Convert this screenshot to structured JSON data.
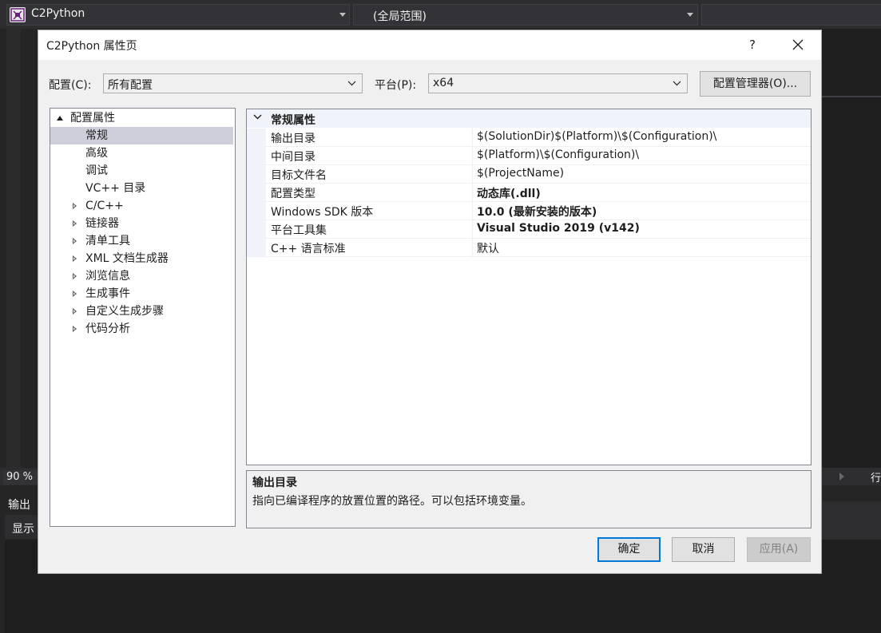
{
  "ide": {
    "project_combo": "C2Python",
    "scope_combo": "(全局范围)",
    "zoom": "90 %",
    "status_right": "行",
    "output_title": "输出",
    "output_show": "显示"
  },
  "dialog": {
    "title": "C2Python 属性页",
    "help": "?",
    "config_label": "配置(C):",
    "config_value": "所有配置",
    "platform_label": "平台(P):",
    "platform_value": "x64",
    "config_manager": "配置管理器(O)...",
    "tree": [
      {
        "label": "配置属性",
        "expander": "expanded",
        "level": 0
      },
      {
        "label": "常规",
        "expander": "none",
        "level": 1,
        "selected": true
      },
      {
        "label": "高级",
        "expander": "none",
        "level": 1
      },
      {
        "label": "调试",
        "expander": "none",
        "level": 1
      },
      {
        "label": "VC++ 目录",
        "expander": "none",
        "level": 1
      },
      {
        "label": "C/C++",
        "expander": "collapsed",
        "level": 1
      },
      {
        "label": "链接器",
        "expander": "collapsed",
        "level": 1
      },
      {
        "label": "清单工具",
        "expander": "collapsed",
        "level": 1
      },
      {
        "label": "XML 文档生成器",
        "expander": "collapsed",
        "level": 1
      },
      {
        "label": "浏览信息",
        "expander": "collapsed",
        "level": 1
      },
      {
        "label": "生成事件",
        "expander": "collapsed",
        "level": 1
      },
      {
        "label": "自定义生成步骤",
        "expander": "collapsed",
        "level": 1
      },
      {
        "label": "代码分析",
        "expander": "collapsed",
        "level": 1
      }
    ],
    "grid": {
      "category": "常规属性",
      "rows": [
        {
          "name": "输出目录",
          "value": "$(SolutionDir)$(Platform)\\$(Configuration)\\",
          "bold": false
        },
        {
          "name": "中间目录",
          "value": "$(Platform)\\$(Configuration)\\",
          "bold": false
        },
        {
          "name": "目标文件名",
          "value": "$(ProjectName)",
          "bold": false
        },
        {
          "name": "配置类型",
          "value": "动态库(.dll)",
          "bold": true
        },
        {
          "name": "Windows SDK 版本",
          "value": "10.0 (最新安装的版本)",
          "bold": true
        },
        {
          "name": "平台工具集",
          "value": "Visual Studio 2019 (v142)",
          "bold": true
        },
        {
          "name": "C++ 语言标准",
          "value": "默认",
          "bold": false
        }
      ]
    },
    "description": {
      "title": "输出目录",
      "text": "指向已编译程序的放置位置的路径。可以包括环境变量。"
    },
    "buttons": {
      "ok": "确定",
      "cancel": "取消",
      "apply": "应用(A)"
    }
  }
}
